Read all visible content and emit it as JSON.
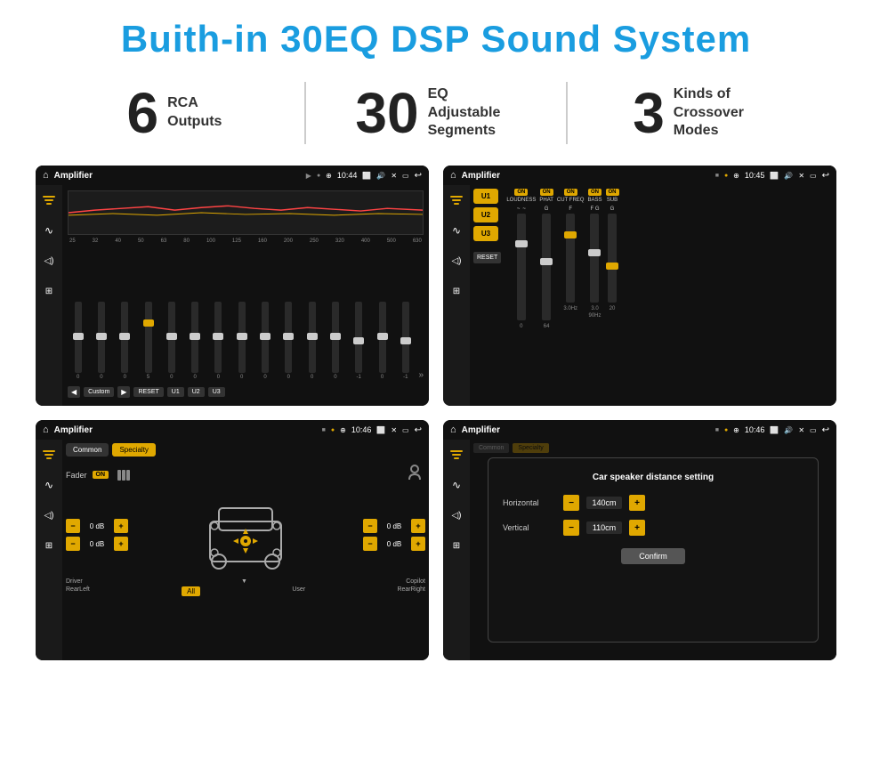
{
  "page": {
    "title": "Buith-in 30EQ DSP Sound System",
    "stats": [
      {
        "number": "6",
        "line1": "RCA",
        "line2": "Outputs"
      },
      {
        "number": "30",
        "line1": "EQ Adjustable",
        "line2": "Segments"
      },
      {
        "number": "3",
        "line1": "Kinds of",
        "line2": "Crossover Modes"
      }
    ]
  },
  "screens": {
    "screen1": {
      "status_title": "Amplifier",
      "time": "10:44",
      "freq_labels": [
        "25",
        "32",
        "40",
        "50",
        "63",
        "80",
        "100",
        "125",
        "160",
        "200",
        "250",
        "320",
        "400",
        "500",
        "630"
      ],
      "slider_values": [
        "0",
        "0",
        "0",
        "5",
        "0",
        "0",
        "0",
        "0",
        "0",
        "0",
        "0",
        "0",
        "-1",
        "0",
        "-1"
      ],
      "bottom_btns": [
        "Custom",
        "RESET",
        "U1",
        "U2",
        "U3"
      ]
    },
    "screen2": {
      "status_title": "Amplifier",
      "time": "10:45",
      "presets": [
        "U1",
        "U2",
        "U3"
      ],
      "reset_label": "RESET",
      "controls": [
        "LOUDNESS",
        "PHAT",
        "CUT FREQ",
        "BASS",
        "SUB"
      ]
    },
    "screen3": {
      "status_title": "Amplifier",
      "time": "10:46",
      "tabs": [
        "Common",
        "Specialty"
      ],
      "fader_label": "Fader",
      "on_badge": "ON",
      "db_values": [
        "0 dB",
        "0 dB",
        "0 dB",
        "0 dB"
      ],
      "bottom_labels": [
        "Driver",
        "",
        "Copilot",
        "RearLeft",
        "All",
        "User",
        "RearRight"
      ]
    },
    "screen4": {
      "status_title": "Amplifier",
      "time": "10:46",
      "dialog_title": "Car speaker distance setting",
      "horizontal_label": "Horizontal",
      "horizontal_value": "140cm",
      "vertical_label": "Vertical",
      "vertical_value": "110cm",
      "confirm_label": "Confirm"
    }
  },
  "icons": {
    "home": "⌂",
    "back": "↩",
    "location": "◉",
    "camera": "📷",
    "volume": "🔊",
    "close": "✕",
    "window": "▭",
    "equalizer": "≡",
    "waveform": "∿",
    "speaker": "◁",
    "expand": "⊞",
    "play": "▶",
    "prev": "◀",
    "next_arrow": "»",
    "settings": "⚙",
    "person": "👤"
  }
}
